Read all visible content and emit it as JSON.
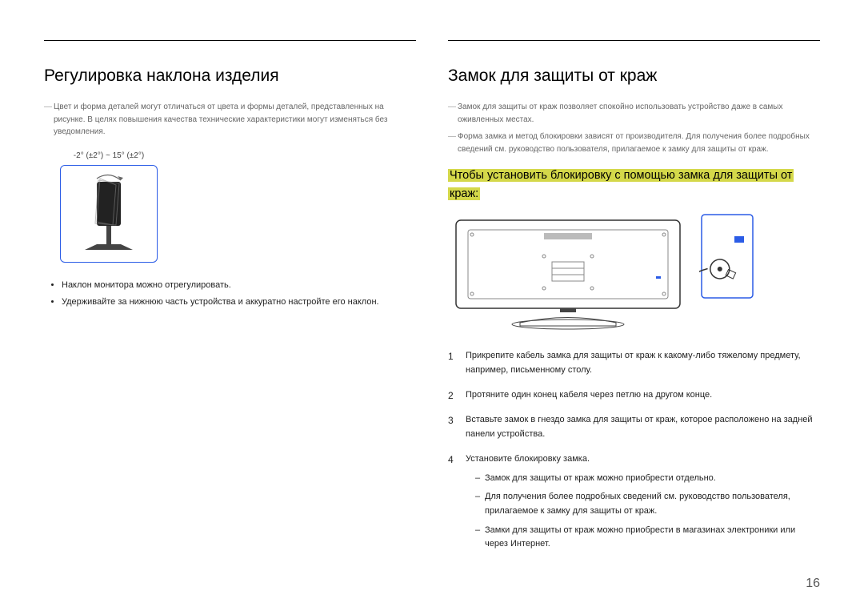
{
  "page_number": "16",
  "left": {
    "title": "Регулировка наклона изделия",
    "notes": [
      "Цвет и форма деталей могут отличаться от цвета и формы деталей, представленных на рисунке. В целях повышения качества технические характеристики могут изменяться без уведомления."
    ],
    "tilt_label": "-2° (±2°) ~ 15° (±2°)",
    "bullets": [
      "Наклон монитора можно отрегулировать.",
      "Удерживайте за нижнюю часть устройства и аккуратно настройте его наклон."
    ]
  },
  "right": {
    "title": "Замок для защиты от краж",
    "notes": [
      "Замок для защиты от краж позволяет спокойно использовать устройство даже в самых оживленных местах.",
      "Форма замка и метод блокировки зависят от производителя. Для получения более подробных сведений см. руководство пользователя, прилагаемое к замку для защиты от краж."
    ],
    "highlight_line1": "Чтобы установить блокировку с помощью замка для защиты от",
    "highlight_line2": "краж:",
    "steps": [
      "Прикрепите кабель замка для защиты от краж к какому-либо тяжелому предмету, например, письменному столу.",
      "Протяните один конец кабеля через петлю на другом конце.",
      "Вставьте замок в гнездо замка  для защиты от краж, которое расположено на задней панели устройства.",
      "Установите блокировку замка."
    ],
    "subnotes": [
      "Замок для защиты от краж можно приобрести отдельно.",
      "Для получения более подробных сведений см. руководство пользователя, прилагаемое к замку для защиты от краж.",
      "Замки для защиты от краж можно приобрести в магазинах электроники или через Интернет."
    ]
  }
}
